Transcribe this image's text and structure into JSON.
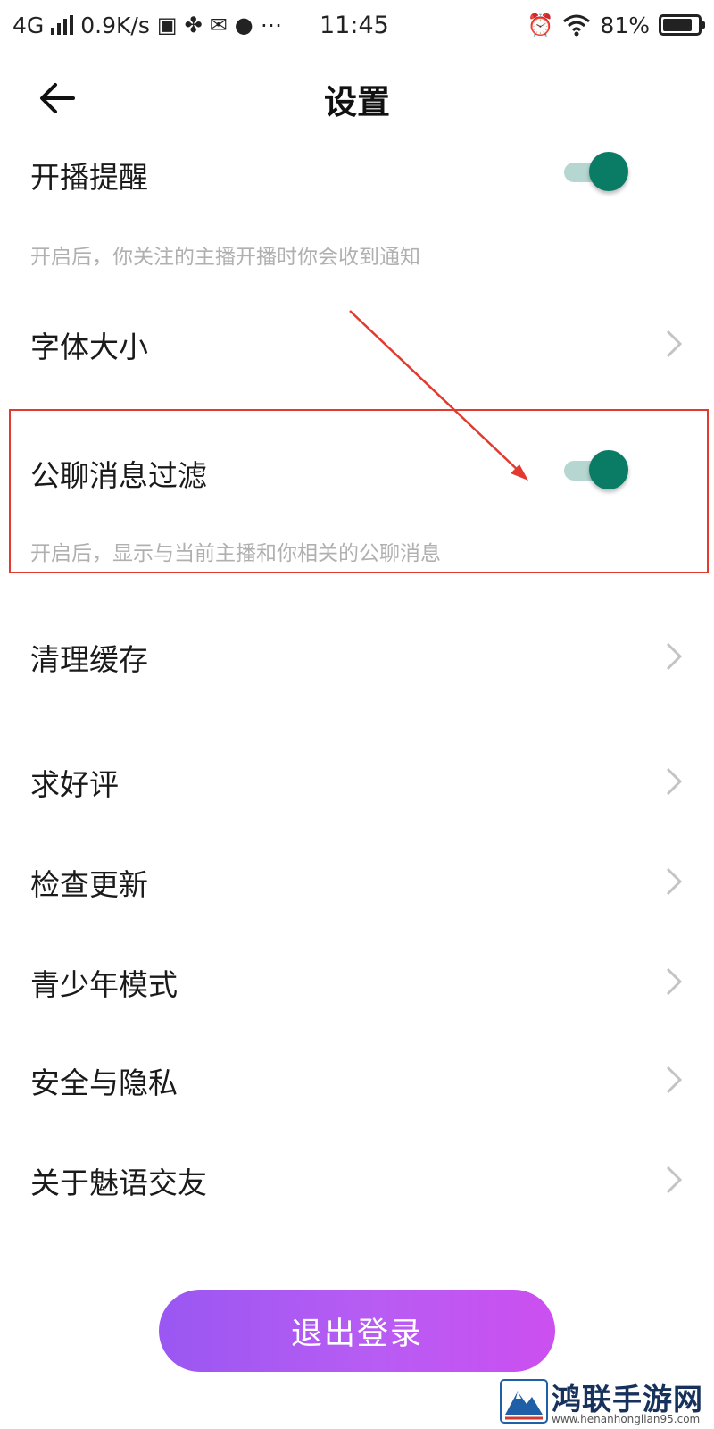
{
  "status_bar": {
    "network": "4G",
    "speed": "0.9K/s",
    "time": "11:45",
    "battery_text": "81%",
    "battery_level": 0.81
  },
  "header": {
    "title": "设置",
    "back_icon": "back-arrow-icon"
  },
  "settings": {
    "live_reminder": {
      "label": "开播提醒",
      "desc": "开启后，你关注的主播开播时你会收到通知",
      "enabled": true
    },
    "font_size": {
      "label": "字体大小"
    },
    "public_chat_filter": {
      "label": "公聊消息过滤",
      "desc": "开启后，显示与当前主播和你相关的公聊消息",
      "enabled": true
    },
    "clear_cache": {
      "label": "清理缓存"
    },
    "rate_us": {
      "label": "求好评"
    },
    "check_update": {
      "label": "检查更新"
    },
    "youth_mode": {
      "label": "青少年模式"
    },
    "security_privacy": {
      "label": "安全与隐私"
    },
    "about": {
      "label": "关于魅语交友"
    }
  },
  "logout": {
    "label": "退出登录"
  },
  "watermark": {
    "name": "鸿联手游网",
    "url": "www.henanhonglian95.com"
  },
  "colors": {
    "toggle_on": "#0a7c66",
    "toggle_track": "#b6d7d1",
    "logout_gradient_start": "#9a57f2",
    "logout_gradient_end": "#cc4ff0",
    "annotation_red": "#e23a2e"
  }
}
